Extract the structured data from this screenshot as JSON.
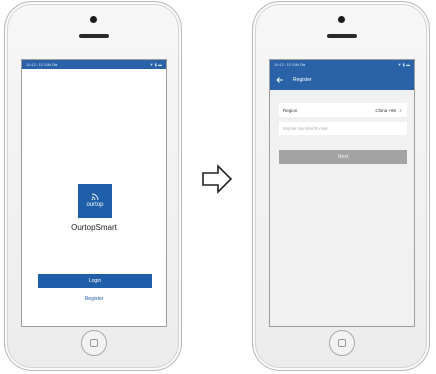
{
  "left_phone": {
    "status_bar": {
      "time": "10:12 ·10 SIM Ba",
      "icons": "▼ ▮ ▬"
    },
    "logo": {
      "text": "ourtop",
      "icon": "wifi-signal-icon",
      "bg_color": "#1f5ea8"
    },
    "app_name": "OurtopSmart",
    "login_label": "Login",
    "register_label": "Register"
  },
  "right_phone": {
    "status_bar": {
      "time": "10:12 ·10 SIM Ba",
      "icons": "▼ ▮ ▬"
    },
    "app_bar": {
      "title": "Register",
      "back_icon": "back-arrow-icon",
      "color": "#2a62a7"
    },
    "region": {
      "label": "Region",
      "value": "China +86",
      "icon": "chevron-right-icon"
    },
    "account_input": {
      "placeholder": "Mobile Number/E-mail",
      "value": ""
    },
    "next_label": "Next",
    "next_color": "#a3a3a3"
  },
  "transition_arrow": {
    "icon": "right-arrow-outline-icon"
  }
}
